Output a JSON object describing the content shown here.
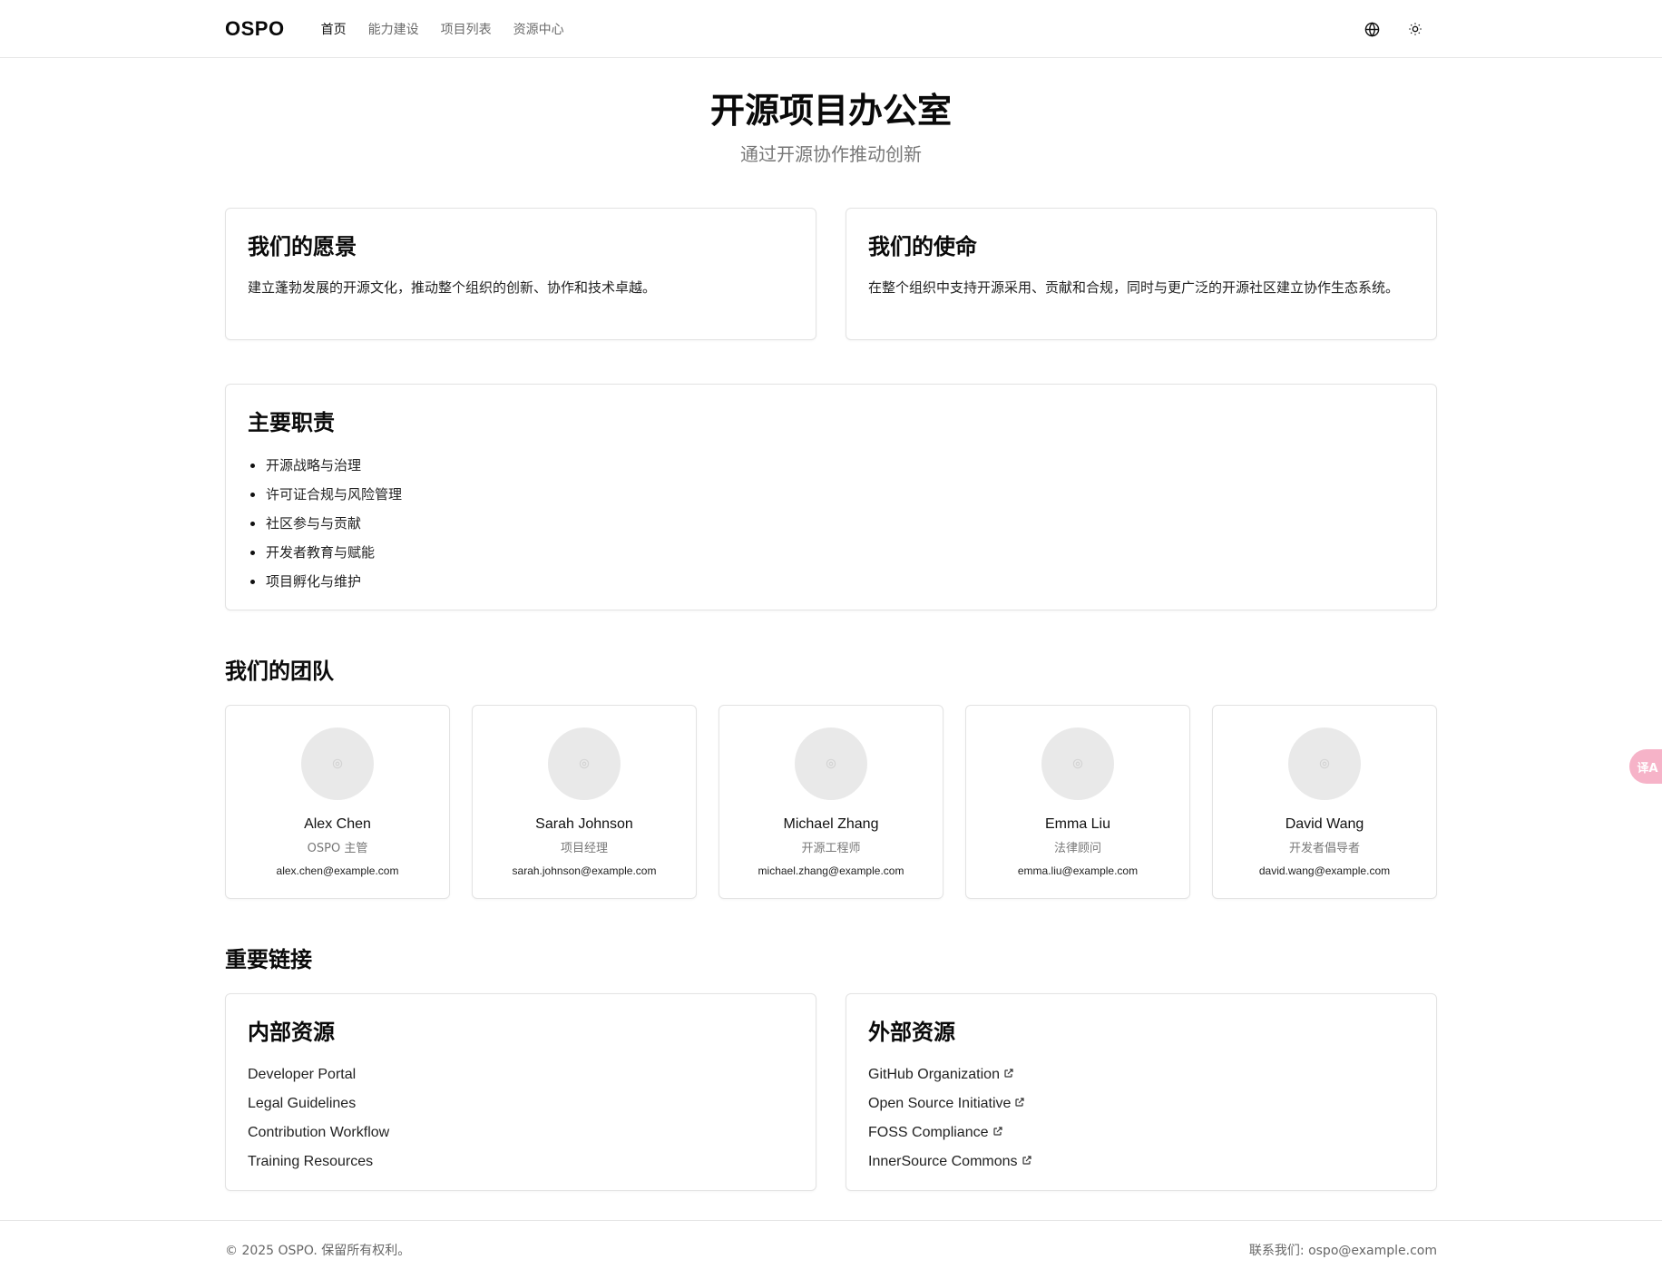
{
  "nav": {
    "brand": "OSPO",
    "links": [
      {
        "label": "首页",
        "active": true
      },
      {
        "label": "能力建设",
        "active": false
      },
      {
        "label": "项目列表",
        "active": false
      },
      {
        "label": "资源中心",
        "active": false
      }
    ],
    "icons": [
      "globe-icon",
      "sun-icon"
    ]
  },
  "hero": {
    "title": "开源项目办公室",
    "subtitle": "通过开源协作推动创新"
  },
  "vision": {
    "title": "我们的愿景",
    "text": "建立蓬勃发展的开源文化，推动整个组织的创新、协作和技术卓越。"
  },
  "mission": {
    "title": "我们的使命",
    "text": "在整个组织中支持开源采用、贡献和合规，同时与更广泛的开源社区建立协作生态系统。"
  },
  "responsibilities": {
    "title": "主要职责",
    "items": [
      "开源战略与治理",
      "许可证合规与风险管理",
      "社区参与与贡献",
      "开发者教育与赋能",
      "项目孵化与维护"
    ]
  },
  "team": {
    "title": "我们的团队",
    "members": [
      {
        "name": "Alex Chen",
        "role": "OSPO 主管",
        "email": "alex.chen@example.com"
      },
      {
        "name": "Sarah Johnson",
        "role": "项目经理",
        "email": "sarah.johnson@example.com"
      },
      {
        "name": "Michael Zhang",
        "role": "开源工程师",
        "email": "michael.zhang@example.com"
      },
      {
        "name": "Emma Liu",
        "role": "法律顾问",
        "email": "emma.liu@example.com"
      },
      {
        "name": "David Wang",
        "role": "开发者倡导者",
        "email": "david.wang@example.com"
      }
    ]
  },
  "links": {
    "title": "重要链接",
    "internal": {
      "title": "内部资源",
      "items": [
        "Developer Portal",
        "Legal Guidelines",
        "Contribution Workflow",
        "Training Resources"
      ]
    },
    "external": {
      "title": "外部资源",
      "items": [
        "GitHub Organization",
        "Open Source Initiative",
        "FOSS Compliance",
        "InnerSource Commons"
      ]
    }
  },
  "footer": {
    "copyright": "© 2025 OSPO. 保留所有权利。",
    "contact": "联系我们: ospo@example.com"
  },
  "translate_fab": {
    "label": "译A"
  },
  "colors": {
    "accent_fab": "#f6b3c8",
    "border": "#e3e3e3",
    "muted": "#777777"
  }
}
